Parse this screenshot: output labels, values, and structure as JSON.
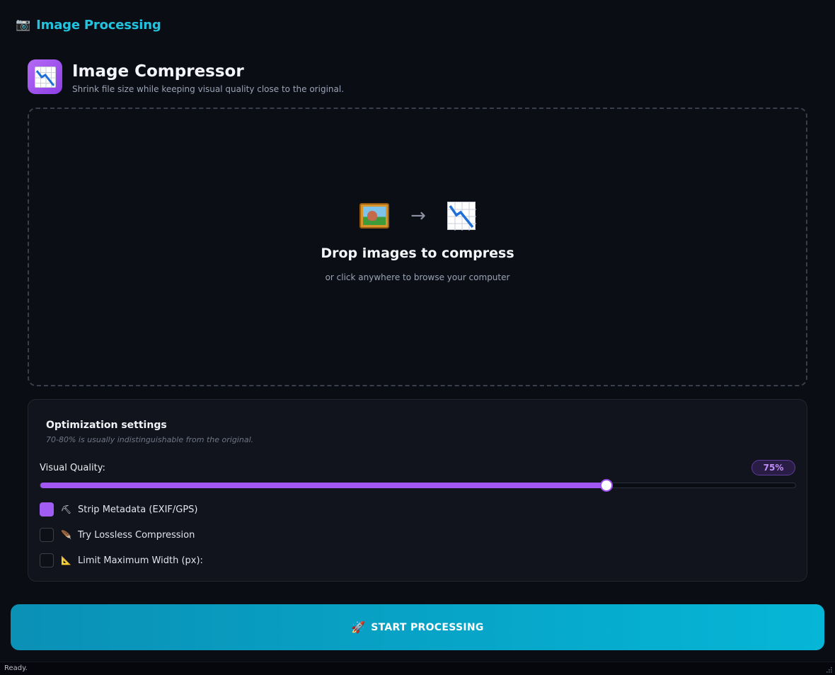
{
  "app": {
    "icon": "camera-icon",
    "title": "Image Processing"
  },
  "tool": {
    "icon": "chart-decreasing-icon",
    "title": "Image Compressor",
    "subtitle": "Shrink file size while keeping visual quality close to the original."
  },
  "dropzone": {
    "from_icon": "framed-picture-icon",
    "arrow": "→",
    "to_icon": "chart-decreasing-icon",
    "title": "Drop images to compress",
    "subtitle": "or click anywhere to browse your computer"
  },
  "settings": {
    "title": "Optimization settings",
    "hint": "70-80% is usually indistinguishable from the original.",
    "quality_label": "Visual Quality:",
    "quality_value": 75,
    "quality_display": "75%",
    "options": [
      {
        "icon": "pick-icon",
        "glyph": "⛏",
        "label": "Strip Metadata (EXIF/GPS)",
        "checked": true
      },
      {
        "icon": "feather-icon",
        "glyph": "🪶",
        "label": "Try Lossless Compression",
        "checked": false
      },
      {
        "icon": "triangular-ruler-icon",
        "glyph": "📐",
        "label": "Limit Maximum Width (px):",
        "checked": false
      }
    ]
  },
  "start_button": {
    "icon": "rocket-icon",
    "label": "START PROCESSING"
  },
  "status": {
    "text": "Ready."
  },
  "colors": {
    "accent_cyan": "#22c3df",
    "accent_purple": "#a357f2",
    "background": "#0b0d14"
  }
}
